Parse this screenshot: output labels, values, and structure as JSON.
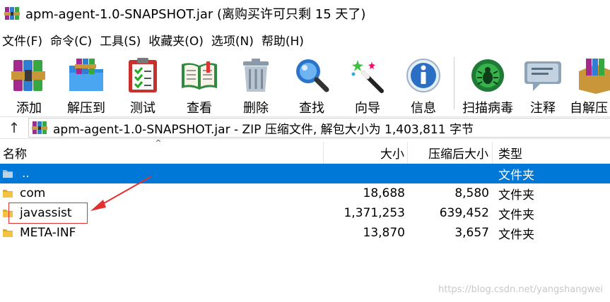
{
  "window": {
    "title": "apm-agent-1.0-SNAPSHOT.jar (离购买许可只剩 15 天了)"
  },
  "menu": [
    {
      "label": "文件(F)"
    },
    {
      "label": "命令(C)"
    },
    {
      "label": "工具(S)"
    },
    {
      "label": "收藏夹(O)"
    },
    {
      "label": "选项(N)"
    },
    {
      "label": "帮助(H)"
    }
  ],
  "toolbar": {
    "items": [
      {
        "label": "添加",
        "icon": "books-icon"
      },
      {
        "label": "解压到",
        "icon": "folder-extract-icon"
      },
      {
        "label": "测试",
        "icon": "clipboard-check-icon"
      },
      {
        "label": "查看",
        "icon": "open-book-icon"
      },
      {
        "label": "删除",
        "icon": "trash-can-icon"
      },
      {
        "label": "查找",
        "icon": "magnifier-icon"
      },
      {
        "label": "向导",
        "icon": "magic-wand-icon"
      },
      {
        "label": "信息",
        "icon": "info-icon"
      },
      {
        "label": "扫描病毒",
        "icon": "virus-scan-icon"
      },
      {
        "label": "注释",
        "icon": "comment-icon"
      },
      {
        "label": "自解压",
        "icon": "sfx-box-icon"
      }
    ]
  },
  "path": {
    "text": "apm-agent-1.0-SNAPSHOT.jar - ZIP 压缩文件, 解包大小为 1,403,811 字节"
  },
  "table": {
    "columns": {
      "name": "名称",
      "size": "大小",
      "packed": "压缩后大小",
      "type": "类型"
    },
    "rows": [
      {
        "name": "..",
        "size": "",
        "packed": "",
        "type": "文件夹",
        "selected": true
      },
      {
        "name": "com",
        "size": "18,688",
        "packed": "8,580",
        "type": "文件夹"
      },
      {
        "name": "javassist",
        "size": "1,371,253",
        "packed": "639,452",
        "type": "文件夹"
      },
      {
        "name": "META-INF",
        "size": "13,870",
        "packed": "3,657",
        "type": "文件夹"
      }
    ]
  },
  "watermark": "https://blog.csdn.net/yangshangwei",
  "colors": {
    "selection": "#0078d7",
    "annotation": "#e23030",
    "folder": "#f5c342"
  }
}
